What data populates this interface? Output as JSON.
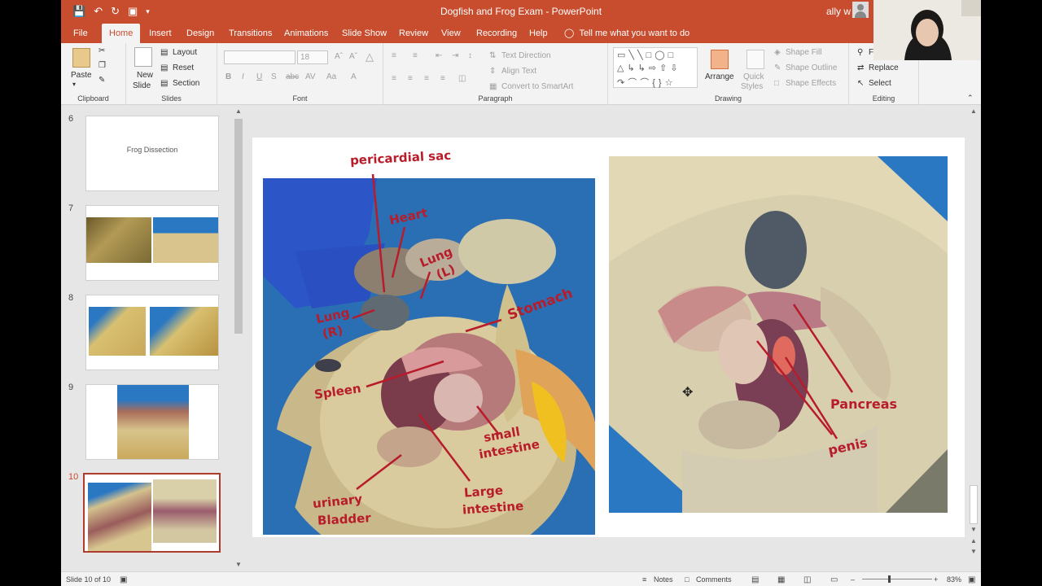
{
  "title_bar": {
    "document_title": "Dogfish and Frog Exam",
    "app_name": "PowerPoint",
    "separator": " - ",
    "user_name": "ally w"
  },
  "tabs": [
    "File",
    "Home",
    "Insert",
    "Design",
    "Transitions",
    "Animations",
    "Slide Show",
    "Review",
    "View",
    "Recording",
    "Help"
  ],
  "active_tab": "Home",
  "tell_me": "Tell me what you want to do",
  "ribbon": {
    "clipboard": {
      "paste": "Paste",
      "label": "Clipboard"
    },
    "slides": {
      "new_slide_1": "New",
      "new_slide_2": "Slide",
      "layout": "Layout",
      "reset": "Reset",
      "section": "Section",
      "label": "Slides"
    },
    "font": {
      "size": "18",
      "label": "Font"
    },
    "paragraph": {
      "text_direction": "Text Direction",
      "align_text": "Align Text",
      "convert": "Convert to SmartArt",
      "label": "Paragraph"
    },
    "drawing": {
      "arrange": "Arrange",
      "quick_1": "Quick",
      "quick_2": "Styles",
      "shape_fill": "Shape Fill",
      "shape_outline": "Shape Outline",
      "shape_effects": "Shape Effects",
      "label": "Drawing"
    },
    "editing": {
      "find": "F",
      "replace": "Replace",
      "select": "Select",
      "label": "Editing"
    }
  },
  "thumbnails": [
    {
      "number": "6",
      "title": "Frog Dissection"
    },
    {
      "number": "7"
    },
    {
      "number": "8"
    },
    {
      "number": "9"
    },
    {
      "number": "10"
    }
  ],
  "slide_labels": {
    "pericardial_sac": "pericardial sac",
    "heart": "Heart",
    "lung_l_1": "Lung",
    "lung_l_2": "(L)",
    "lung_r_1": "Lung",
    "lung_r_2": "(R)",
    "stomach": "Stomach",
    "spleen": "Spleen",
    "small_intestine_1": "small",
    "small_intestine_2": "intestine",
    "urinary_bladder_1": "urinary",
    "urinary_bladder_2": "Bladder",
    "large_intestine_1": "Large",
    "large_intestine_2": "intestine",
    "pancreas": "Pancreas",
    "penis": "penis"
  },
  "status_bar": {
    "slide_info": "Slide 10 of 10",
    "notes": "Notes",
    "comments": "Comments",
    "zoom": "83%"
  },
  "colors": {
    "accent": "#c84c2e",
    "annotation_red": "#b81c2a",
    "tray_blue": "#2b78c2"
  }
}
